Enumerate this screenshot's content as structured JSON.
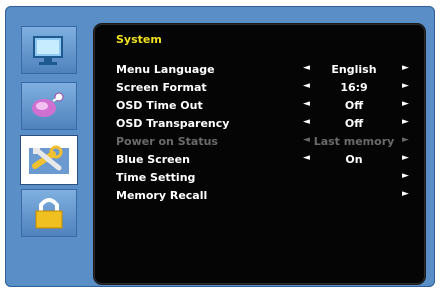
{
  "sidebar": {
    "items": [
      {
        "icon": "monitor-icon",
        "selected": false
      },
      {
        "icon": "sound-icon",
        "selected": false
      },
      {
        "icon": "tools-icon",
        "selected": true
      },
      {
        "icon": "lock-icon",
        "selected": false
      }
    ]
  },
  "panel": {
    "title": "System",
    "arrow_left": "◄",
    "arrow_right": "►",
    "rows": [
      {
        "label": "Menu Language",
        "value": "English",
        "enabled": true
      },
      {
        "label": "Screen Format",
        "value": "16:9",
        "enabled": true
      },
      {
        "label": "OSD Time Out",
        "value": "Off",
        "enabled": true
      },
      {
        "label": "OSD Transparency",
        "value": "Off",
        "enabled": true
      },
      {
        "label": "Power on Status",
        "value": "Last memory",
        "enabled": false
      },
      {
        "label": "Blue Screen",
        "value": "On",
        "enabled": true
      },
      {
        "label": "Time Setting",
        "value": "",
        "enabled": true
      },
      {
        "label": "Memory Recall",
        "value": "",
        "enabled": true
      }
    ]
  },
  "colors": {
    "title": "#f0e020",
    "text": "#ffffff",
    "disabled": "#6a6a6a",
    "frame": "#5a8ec6",
    "panel": "#050505"
  }
}
